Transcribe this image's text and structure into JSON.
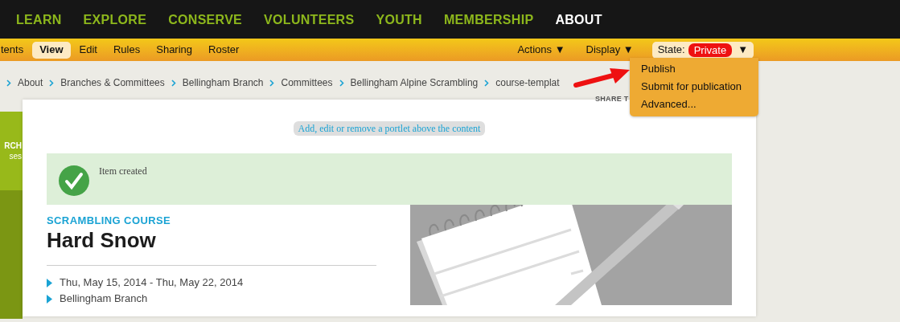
{
  "top_nav": [
    {
      "label": "LEARN",
      "selected": false
    },
    {
      "label": "EXPLORE",
      "selected": false
    },
    {
      "label": "CONSERVE",
      "selected": false
    },
    {
      "label": "VOLUNTEERS",
      "selected": false
    },
    {
      "label": "YOUTH",
      "selected": false
    },
    {
      "label": "MEMBERSHIP",
      "selected": false
    },
    {
      "label": "ABOUT",
      "selected": true
    }
  ],
  "toolbar": {
    "tabs": [
      {
        "label": "tents",
        "selected": false
      },
      {
        "label": "View",
        "selected": true
      },
      {
        "label": "Edit",
        "selected": false
      },
      {
        "label": "Rules",
        "selected": false
      },
      {
        "label": "Sharing",
        "selected": false
      },
      {
        "label": "Roster",
        "selected": false
      }
    ],
    "menus": [
      {
        "label": "Actions",
        "caret": "▼"
      },
      {
        "label": "Display",
        "caret": "▼"
      }
    ],
    "state": {
      "label": "State:",
      "value": "Private",
      "caret": "▼",
      "expanded": true
    }
  },
  "state_menu": {
    "items": [
      "Publish",
      "Submit for publication",
      "Advanced..."
    ]
  },
  "breadcrumbs": [
    "About",
    "Branches & Committees",
    "Bellingham Branch",
    "Committees",
    "Bellingham Alpine Scrambling",
    "course-templat"
  ],
  "share_label": "SHARE T",
  "sidebar": {
    "lines": [
      "RCH",
      "ses"
    ]
  },
  "portlet_link": "Add, edit or remove a portlet above the content",
  "alert": {
    "message": "Item created"
  },
  "event": {
    "category": "SCRAMBLING COURSE",
    "title": "Hard Snow",
    "details": [
      "Thu, May 15, 2014 - Thu, May 22, 2014",
      "Bellingham Branch"
    ]
  }
}
